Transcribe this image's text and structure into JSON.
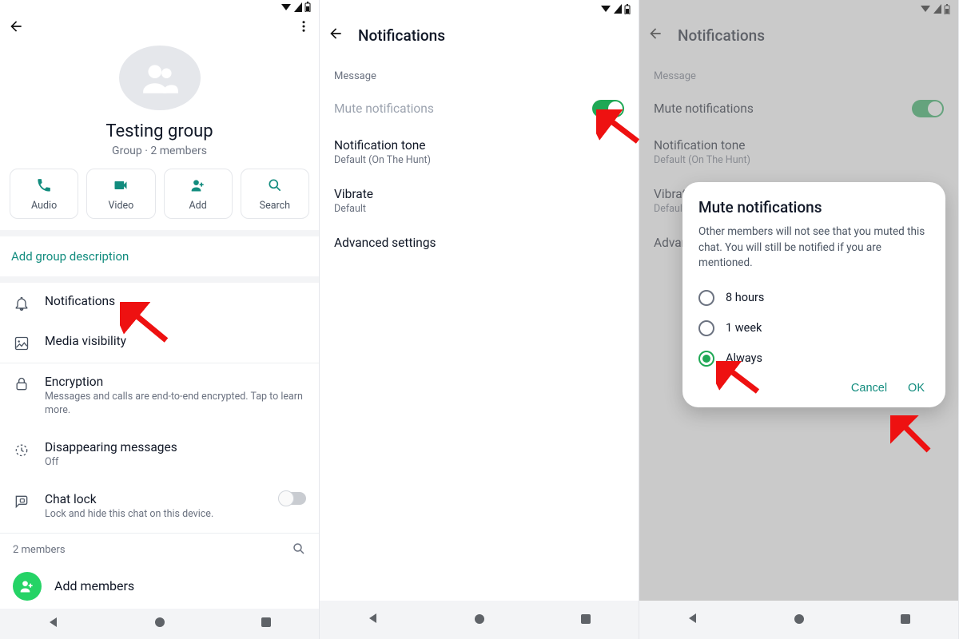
{
  "screens": {
    "group_info": {
      "title": "Testing group",
      "subtitle": "Group · 2 members",
      "actions": {
        "audio": "Audio",
        "video": "Video",
        "add": "Add",
        "search": "Search"
      },
      "add_description": "Add group description",
      "items": {
        "notifications": "Notifications",
        "media_visibility": "Media visibility",
        "encryption_title": "Encryption",
        "encryption_sub": "Messages and calls are end-to-end encrypted. Tap to learn more.",
        "disappearing_title": "Disappearing messages",
        "disappearing_sub": "Off",
        "chatlock_title": "Chat lock",
        "chatlock_sub": "Lock and hide this chat on this device."
      },
      "members_count": "2 members",
      "add_members": "Add members"
    },
    "notifications": {
      "appbar_title": "Notifications",
      "section_message": "Message",
      "mute": "Mute notifications",
      "tone_title": "Notification tone",
      "tone_sub": "Default (On The Hunt)",
      "vibrate_title": "Vibrate",
      "vibrate_sub": "Default",
      "advanced": "Advanced settings"
    },
    "dialog": {
      "title": "Mute notifications",
      "body": "Other members will not see that you muted this chat. You will still be notified if you are mentioned.",
      "opt_8h": "8 hours",
      "opt_1w": "1 week",
      "opt_always": "Always",
      "cancel": "Cancel",
      "ok": "OK"
    }
  }
}
